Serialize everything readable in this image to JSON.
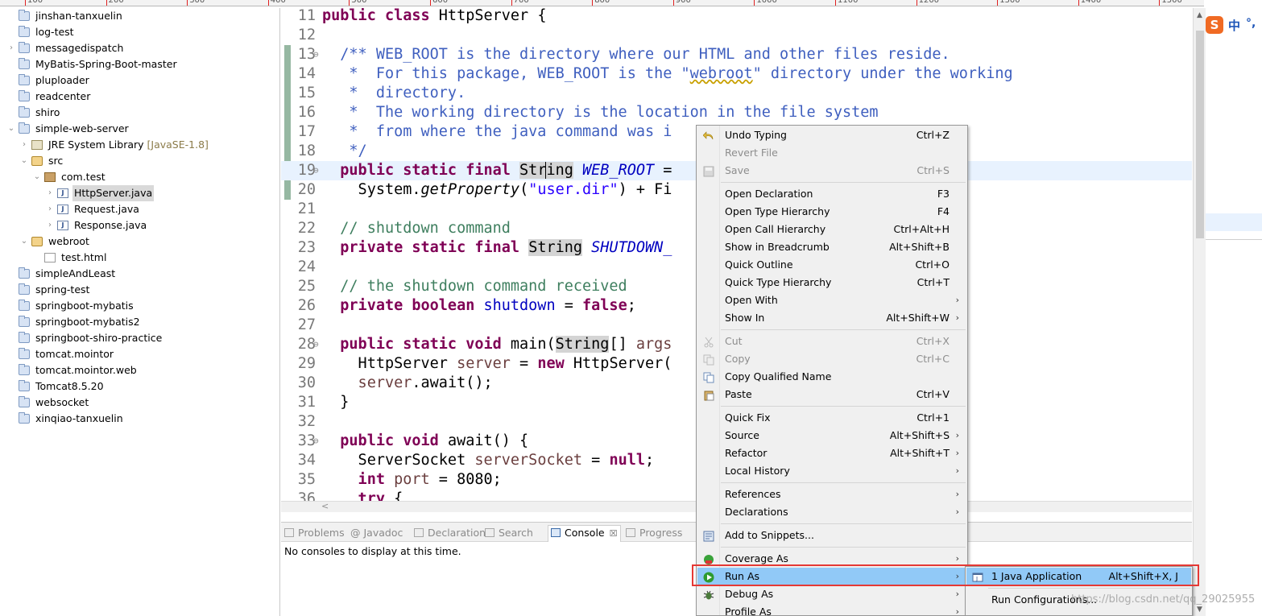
{
  "ruler": [
    "100",
    "200",
    "300",
    "400",
    "500",
    "600",
    "700",
    "800",
    "900",
    "1000",
    "1100",
    "1200",
    "1300",
    "1400",
    "1500"
  ],
  "tree": {
    "items": [
      {
        "label": "jinshan-tanxuelin",
        "type": "project"
      },
      {
        "label": "log-test",
        "type": "project"
      },
      {
        "label": "messagedispatch",
        "type": "project",
        "expander": "›"
      },
      {
        "label": "MyBatis-Spring-Boot-master",
        "type": "project"
      },
      {
        "label": "pluploader",
        "type": "project"
      },
      {
        "label": "readcenter",
        "type": "project"
      },
      {
        "label": "shiro",
        "type": "project"
      },
      {
        "label": "simple-web-server",
        "type": "project",
        "expander": "⌄"
      },
      {
        "label": "JRE System Library",
        "decor": "[JavaSE-1.8]",
        "type": "library",
        "expander": "›"
      },
      {
        "label": "src",
        "type": "source-folder",
        "expander": "⌄"
      },
      {
        "label": "com.test",
        "type": "package",
        "expander": "⌄"
      },
      {
        "label": "HttpServer.java",
        "type": "java",
        "expander": "›",
        "selected": true
      },
      {
        "label": "Request.java",
        "type": "java",
        "expander": "›"
      },
      {
        "label": "Response.java",
        "type": "java",
        "expander": "›"
      },
      {
        "label": "webroot",
        "type": "source-folder",
        "expander": "⌄"
      },
      {
        "label": "test.html",
        "type": "file"
      },
      {
        "label": "simpleAndLeast",
        "type": "project"
      },
      {
        "label": "spring-test",
        "type": "project"
      },
      {
        "label": "springboot-mybatis",
        "type": "project"
      },
      {
        "label": "springboot-mybatis2",
        "type": "project"
      },
      {
        "label": "springboot-shiro-practice",
        "type": "project"
      },
      {
        "label": "tomcat.mointor",
        "type": "project"
      },
      {
        "label": "tomcat.mointor.web",
        "type": "project"
      },
      {
        "label": "Tomcat8.5.20",
        "type": "project"
      },
      {
        "label": "websocket",
        "type": "project"
      },
      {
        "label": "xinqiao-tanxuelin",
        "type": "project"
      }
    ]
  },
  "editor": {
    "lines": [
      {
        "n": "11",
        "segs": [
          [
            "kw",
            "public class "
          ],
          [
            "",
            "HttpServer {"
          ]
        ]
      },
      {
        "n": "12",
        "segs": []
      },
      {
        "n": "13",
        "fold": true,
        "segs": [
          [
            "dc",
            "  /** WEB_ROOT is the directory where our HTML and other files reside."
          ]
        ]
      },
      {
        "n": "14",
        "segs": [
          [
            "dc",
            "   *  For this package, WEB_ROOT is the \""
          ],
          [
            "dc squig",
            "webroot"
          ],
          [
            "dc",
            "\" directory under the working"
          ]
        ]
      },
      {
        "n": "15",
        "segs": [
          [
            "dc",
            "   *  directory."
          ]
        ]
      },
      {
        "n": "16",
        "segs": [
          [
            "dc",
            "   *  The working directory is the location in the file system"
          ]
        ]
      },
      {
        "n": "17",
        "segs": [
          [
            "dc",
            "   *  from where the java command was i"
          ]
        ]
      },
      {
        "n": "18",
        "segs": [
          [
            "dc",
            "   */"
          ]
        ]
      },
      {
        "n": "19",
        "fold": true,
        "current": true,
        "segs": [
          [
            "kw",
            "  public static final "
          ],
          [
            "occ",
            "String"
          ],
          [
            "",
            " "
          ],
          [
            "fld",
            "WEB_ROOT"
          ],
          [
            "",
            " ="
          ]
        ]
      },
      {
        "n": "20",
        "segs": [
          [
            "",
            "    System."
          ],
          [
            "mth",
            "getProperty"
          ],
          [
            "",
            "("
          ],
          [
            "str",
            "\"user.dir\""
          ],
          [
            "",
            ") + Fi"
          ]
        ]
      },
      {
        "n": "21",
        "segs": []
      },
      {
        "n": "22",
        "segs": [
          [
            "cm",
            "  // shutdown command"
          ]
        ]
      },
      {
        "n": "23",
        "segs": [
          [
            "kw",
            "  private static final "
          ],
          [
            "occ",
            "String"
          ],
          [
            "",
            " "
          ],
          [
            "fld",
            "SHUTDOWN_"
          ]
        ]
      },
      {
        "n": "24",
        "segs": []
      },
      {
        "n": "25",
        "segs": [
          [
            "cm",
            "  // the shutdown command received"
          ]
        ]
      },
      {
        "n": "26",
        "segs": [
          [
            "kw",
            "  private boolean "
          ],
          [
            "fld2",
            "shutdown"
          ],
          [
            "",
            " = "
          ],
          [
            "kw",
            "false"
          ],
          [
            "",
            ";"
          ]
        ]
      },
      {
        "n": "27",
        "segs": []
      },
      {
        "n": "28",
        "fold": true,
        "segs": [
          [
            "kw",
            "  public static void "
          ],
          [
            "",
            "main("
          ],
          [
            "occ",
            "String"
          ],
          [
            "",
            "[] "
          ],
          [
            "var",
            "args"
          ]
        ]
      },
      {
        "n": "29",
        "segs": [
          [
            "",
            "    HttpServer "
          ],
          [
            "var",
            "server"
          ],
          [
            "",
            " = "
          ],
          [
            "kw",
            "new "
          ],
          [
            "",
            "HttpServer("
          ]
        ]
      },
      {
        "n": "30",
        "segs": [
          [
            "var",
            "    server"
          ],
          [
            "",
            ".await();"
          ]
        ]
      },
      {
        "n": "31",
        "segs": [
          [
            "",
            "  }"
          ]
        ]
      },
      {
        "n": "32",
        "segs": []
      },
      {
        "n": "33",
        "fold": true,
        "segs": [
          [
            "kw",
            "  public void "
          ],
          [
            "",
            "await() {"
          ]
        ]
      },
      {
        "n": "34",
        "segs": [
          [
            "",
            "    ServerSocket "
          ],
          [
            "var",
            "serverSocket"
          ],
          [
            "",
            " = "
          ],
          [
            "kw",
            "null"
          ],
          [
            "",
            ";"
          ]
        ]
      },
      {
        "n": "35",
        "segs": [
          [
            "kw",
            "    int "
          ],
          [
            "var",
            "port"
          ],
          [
            "",
            " = 8080;"
          ]
        ]
      },
      {
        "n": "36",
        "segs": [
          [
            "kw",
            "    try "
          ],
          [
            "",
            "{"
          ]
        ]
      }
    ],
    "hscroll_arrow": "<"
  },
  "console": {
    "tabs": [
      {
        "label": "Problems",
        "active": false
      },
      {
        "label": "Javadoc",
        "active": false,
        "prefix": "@"
      },
      {
        "label": "Declaration",
        "active": false
      },
      {
        "label": "Search",
        "active": false
      },
      {
        "label": "Console",
        "active": true,
        "close": "☒"
      },
      {
        "label": "Progress",
        "active": false
      }
    ],
    "message": "No consoles to display at this time."
  },
  "context_menu": {
    "items": [
      {
        "label": "Undo Typing",
        "shortcut": "Ctrl+Z",
        "icon": "undo-icon"
      },
      {
        "label": "Revert File",
        "disabled": true
      },
      {
        "label": "Save",
        "shortcut": "Ctrl+S",
        "disabled": true,
        "icon": "save-icon"
      },
      {
        "sep": true
      },
      {
        "label": "Open Declaration",
        "shortcut": "F3"
      },
      {
        "label": "Open Type Hierarchy",
        "shortcut": "F4"
      },
      {
        "label": "Open Call Hierarchy",
        "shortcut": "Ctrl+Alt+H"
      },
      {
        "label": "Show in Breadcrumb",
        "shortcut": "Alt+Shift+B"
      },
      {
        "label": "Quick Outline",
        "shortcut": "Ctrl+O"
      },
      {
        "label": "Quick Type Hierarchy",
        "shortcut": "Ctrl+T"
      },
      {
        "label": "Open With",
        "submenu": true
      },
      {
        "label": "Show In",
        "shortcut": "Alt+Shift+W",
        "submenu": true
      },
      {
        "sep": true
      },
      {
        "label": "Cut",
        "shortcut": "Ctrl+X",
        "disabled": true,
        "icon": "cut-icon"
      },
      {
        "label": "Copy",
        "shortcut": "Ctrl+C",
        "disabled": true,
        "icon": "copy-icon"
      },
      {
        "label": "Copy Qualified Name",
        "icon": "copy-qualified-icon"
      },
      {
        "label": "Paste",
        "shortcut": "Ctrl+V",
        "icon": "paste-icon"
      },
      {
        "sep": true
      },
      {
        "label": "Quick Fix",
        "shortcut": "Ctrl+1"
      },
      {
        "label": "Source",
        "shortcut": "Alt+Shift+S",
        "submenu": true
      },
      {
        "label": "Refactor",
        "shortcut": "Alt+Shift+T",
        "submenu": true
      },
      {
        "label": "Local History",
        "submenu": true
      },
      {
        "sep": true
      },
      {
        "label": "References",
        "submenu": true
      },
      {
        "label": "Declarations",
        "submenu": true
      },
      {
        "sep": true
      },
      {
        "label": "Add to Snippets...",
        "icon": "snippets-icon"
      },
      {
        "sep": true
      },
      {
        "label": "Coverage As",
        "submenu": true,
        "icon": "coverage-icon"
      },
      {
        "label": "Run As",
        "submenu": true,
        "highlight": true,
        "icon": "run-icon"
      },
      {
        "label": "Debug As",
        "submenu": true,
        "icon": "debug-icon"
      },
      {
        "label": "Profile As",
        "submenu": true
      }
    ]
  },
  "submenu": {
    "items": [
      {
        "label": "1 Java Application",
        "shortcut": "Alt+Shift+X, J",
        "highlight": true,
        "icon": "java-application-icon"
      },
      {
        "sep": true
      },
      {
        "label": "Run Configurations..."
      }
    ]
  },
  "ime": {
    "logo": "S",
    "lang": "中",
    "punc": "°,"
  },
  "watermark": "https://blog.csdn.net/qq_29025955",
  "colors": {
    "keyword": "#7f0055",
    "comment": "#3f7f5f",
    "javadoc": "#3f5fbf",
    "string": "#2a00ff",
    "field": "#0000c0",
    "highlight": "#91c9f7",
    "redbox": "#e53935"
  }
}
